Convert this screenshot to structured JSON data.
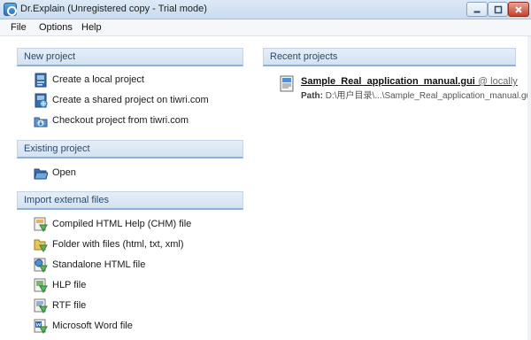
{
  "window": {
    "title": "Dr.Explain (Unregistered copy - Trial mode)"
  },
  "menu": [
    "File",
    "Options",
    "Help"
  ],
  "sections": {
    "new_project": {
      "title": "New project",
      "items": [
        {
          "label": "Create a local project",
          "icon": "local-project-icon"
        },
        {
          "label": "Create a shared project on tiwri.com",
          "icon": "shared-project-icon"
        },
        {
          "label": "Checkout project from tiwri.com",
          "icon": "checkout-icon"
        }
      ]
    },
    "existing_project": {
      "title": "Existing project",
      "items": [
        {
          "label": "Open",
          "icon": "open-folder-icon"
        }
      ]
    },
    "import_files": {
      "title": "Import external files",
      "items": [
        {
          "label": "Compiled HTML Help (CHM) file",
          "icon": "chm-file-icon"
        },
        {
          "label": "Folder with files (html, txt, xml)",
          "icon": "folder-files-icon"
        },
        {
          "label": "Standalone HTML file",
          "icon": "html-file-icon"
        },
        {
          "label": "HLP file",
          "icon": "hlp-file-icon"
        },
        {
          "label": "RTF file",
          "icon": "rtf-file-icon"
        },
        {
          "label": "Microsoft Word file",
          "icon": "word-file-icon"
        }
      ]
    },
    "recent_projects": {
      "title": "Recent projects",
      "items": [
        {
          "name": "Sample_Real_application_manual.gui",
          "location": "@ locally",
          "path_label": "Path:",
          "path": "D:\\用户目录\\...\\Sample_Real_application_manual.gui"
        }
      ]
    }
  },
  "colors": {
    "header_bg": "#d4e2f1",
    "header_border": "#8fb0d6",
    "header_text": "#2b4a6e"
  }
}
